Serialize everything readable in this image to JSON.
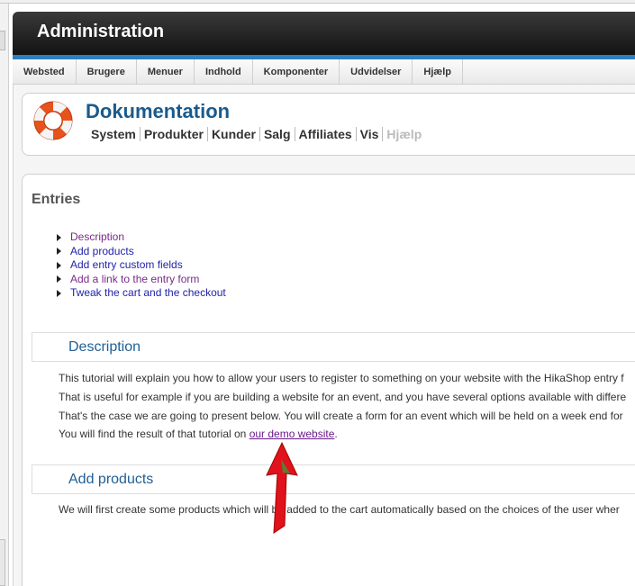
{
  "admin": {
    "title": "Administration"
  },
  "menu": [
    "Websted",
    "Brugere",
    "Menuer",
    "Indhold",
    "Komponenter",
    "Udvidelser",
    "Hjælp"
  ],
  "doc": {
    "title": "Dokumentation",
    "links": [
      "System",
      "Produkter",
      "Kunder",
      "Salg",
      "Affiliates",
      "Vis",
      "Hjælp"
    ]
  },
  "entries": {
    "heading": "Entries",
    "toc": [
      "Description",
      "Add products",
      "Add entry custom fields",
      "Add a link to the entry form",
      "Tweak the cart and the checkout"
    ]
  },
  "description": {
    "heading": "Description",
    "lines": [
      "This tutorial will explain you how to allow your users to register to something on your website with the HikaShop entry f",
      "That is useful for example if you are building a website for an event, and you have several options available with differe",
      "That's the case we are going to present below. You will create a form for an event which will be held on a week end for"
    ],
    "result_prefix": "You will find the result of that tutorial on ",
    "result_link": "our demo website",
    "result_suffix": "."
  },
  "products": {
    "heading": "Add products",
    "line": "We will first create some products which will be added to the cart automatically based on the choices of the user wher"
  },
  "colors": {
    "accent": "#2c7fc0",
    "heading_blue": "#1f5f95",
    "arrow_red": "#e0121b"
  }
}
